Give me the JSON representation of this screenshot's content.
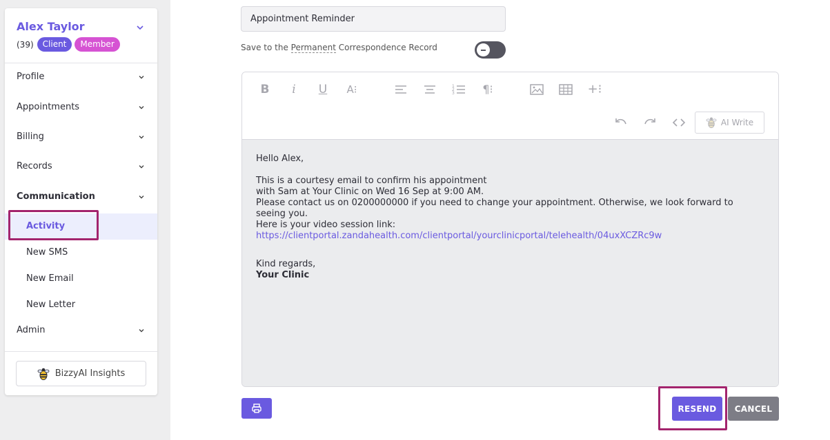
{
  "patient": {
    "name": "Alex Taylor",
    "count": "(39)",
    "badges": [
      "Client",
      "Member"
    ]
  },
  "sidebar": {
    "items": [
      {
        "label": "Profile"
      },
      {
        "label": "Appointments"
      },
      {
        "label": "Billing"
      },
      {
        "label": "Records"
      },
      {
        "label": "Communication"
      },
      {
        "label": "Admin"
      }
    ],
    "communication_sub": [
      {
        "label": "Activity"
      },
      {
        "label": "New SMS"
      },
      {
        "label": "New Email"
      },
      {
        "label": "New Letter"
      }
    ],
    "insights_label": "BizzyAI Insights"
  },
  "form": {
    "subject_value": "Appointment Reminder",
    "save_label_prefix": "Save to the ",
    "save_label_link": "Permanent",
    "save_label_suffix": " Correspondence Record",
    "save_toggle_on": false
  },
  "editor": {
    "ai_write_label": "AI Write",
    "toolbar_icons": [
      "bold-icon",
      "italic-icon",
      "underline-icon",
      "font-size-icon",
      "align-left-icon",
      "align-center-icon",
      "ordered-list-icon",
      "paragraph-icon",
      "image-icon",
      "table-icon",
      "insert-more-icon",
      "undo-icon",
      "redo-icon",
      "code-view-icon"
    ],
    "body": {
      "greeting": "Hello Alex,",
      "line1": "This is a courtesy email to confirm his appointment",
      "line2": "with Sam at Your Clinic on Wed 16 Sep at 9:00 AM.",
      "line3": "Please contact us on 0200000000 if you need to change your appointment. Otherwise, we look forward to seeing you.",
      "line4": "Here is your video session link:",
      "link": "https://clientportal.zandahealth.com/clientportal/yourclinicportal/telehealth/04uxXCZRc9w",
      "closing": "Kind regards,",
      "signature": "Your Clinic"
    }
  },
  "actions": {
    "resend_label": "RESEND",
    "cancel_label": "CANCEL"
  },
  "colors": {
    "accent": "#6a5ae0",
    "member_badge": "#d653d3",
    "highlight_outline": "#a3246d",
    "cancel": "#7d7d86"
  }
}
